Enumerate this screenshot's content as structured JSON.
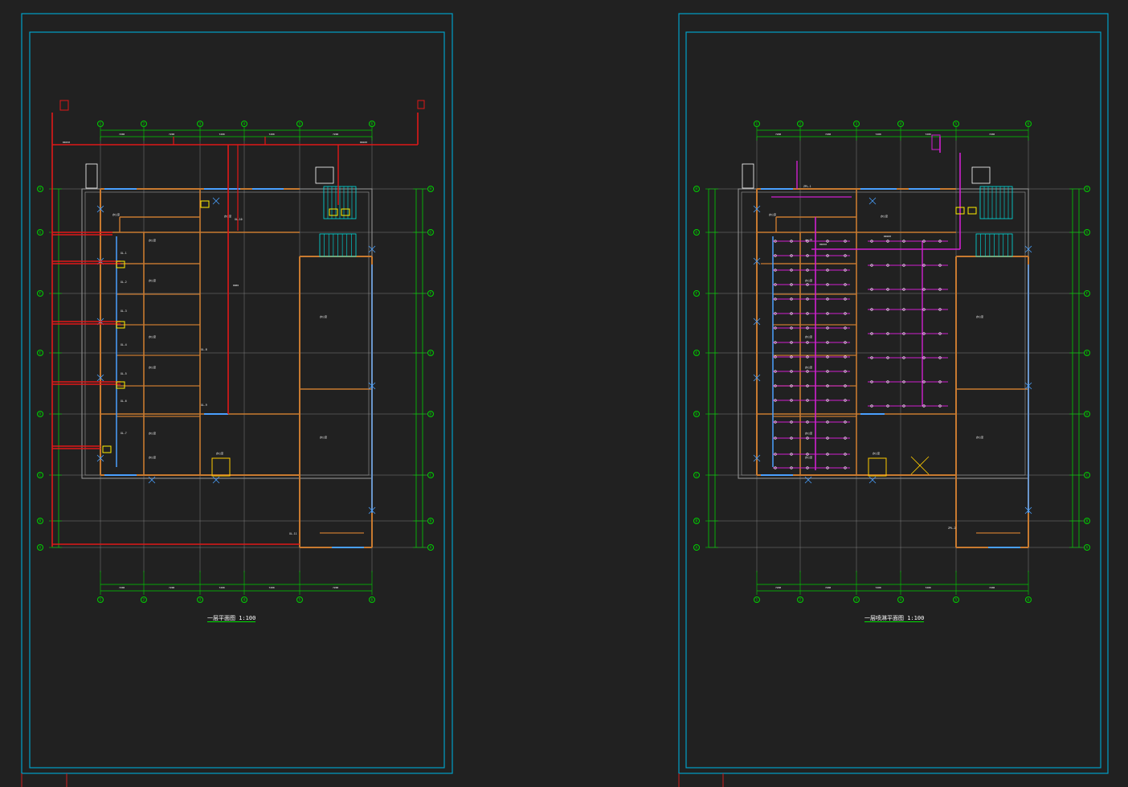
{
  "sheets": [
    {
      "title": "一层平面图 1:100",
      "grid_top": [
        "1",
        "2",
        "3",
        "4",
        "5",
        "6"
      ],
      "grid_side": [
        "H",
        "G",
        "F",
        "E",
        "D",
        "C",
        "B",
        "A"
      ],
      "tags": [
        "XL-1",
        "XL-2",
        "XL-3",
        "XL-4",
        "XL-5",
        "XL-6",
        "XL-7",
        "XL-8",
        "XL-9",
        "XL-10",
        "XL-11"
      ],
      "notes": [
        "DN150",
        "DN100",
        "DN65"
      ]
    },
    {
      "title": "一层喷淋平面图 1:100",
      "grid_top": [
        "1",
        "2",
        "3",
        "4",
        "5",
        "6"
      ],
      "grid_side": [
        "H",
        "G",
        "F",
        "E",
        "D",
        "C",
        "B",
        "A"
      ],
      "tags": [
        "ZPL-1",
        "ZPL-2"
      ],
      "notes": [
        "DN150",
        "DN100"
      ]
    }
  ],
  "colors": {
    "background": "#212121",
    "frame": "#00a0c8",
    "grid": "#00d000",
    "wall": "#c87a30",
    "pipe_fire": "#e01818",
    "pipe_sprinkler": "#d020d0",
    "text": "#ffffff",
    "axis": "#808080"
  },
  "icons": [
    "stair-icon",
    "elevator-icon",
    "hydrant-icon",
    "sprinkler-head-icon",
    "door-swing-icon",
    "grid-bubble-icon"
  ]
}
